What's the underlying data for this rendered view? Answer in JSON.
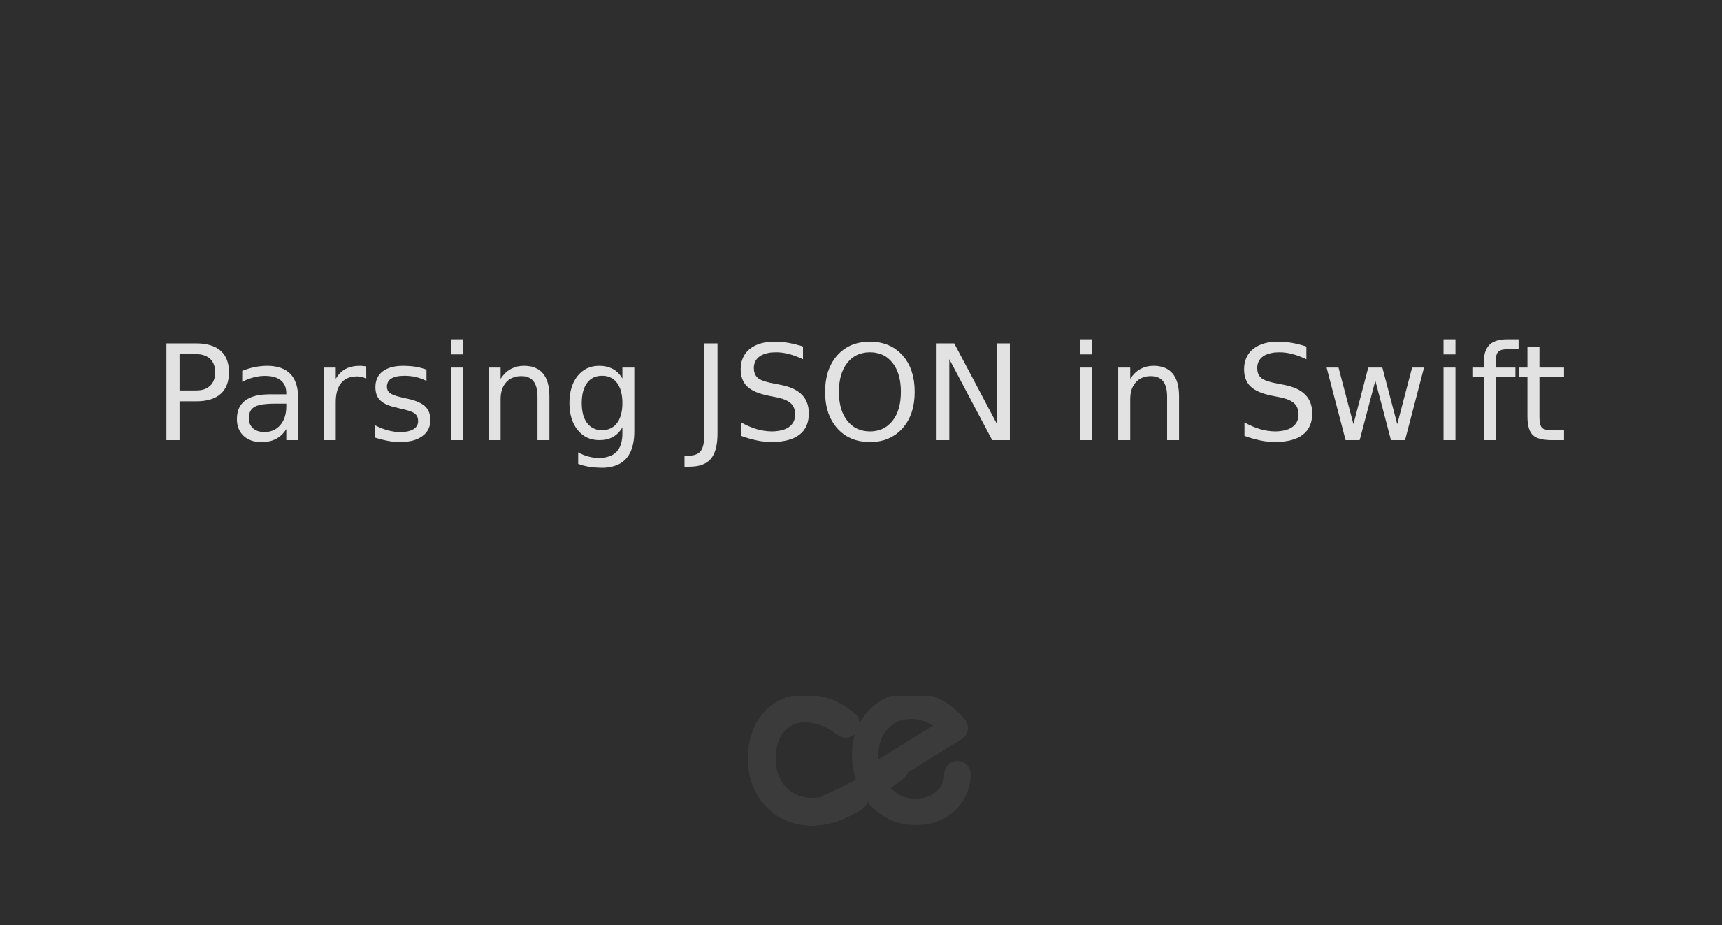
{
  "slide": {
    "title": "Parsing JSON in Swift",
    "background_color": "#2e2e2e",
    "title_color": "#e2e2e2"
  },
  "logo": {
    "icon": "ce-logo-icon",
    "color": "#3b3b3b"
  }
}
